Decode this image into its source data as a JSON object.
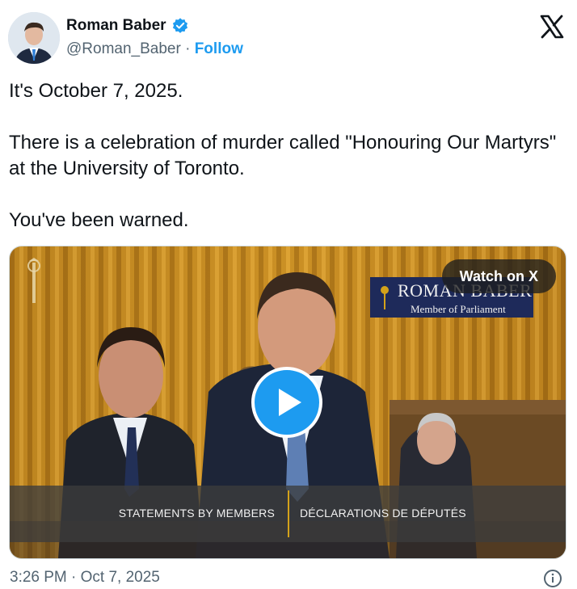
{
  "author": {
    "name": "Roman Baber",
    "handle": "@Roman_Baber",
    "separator": "·",
    "follow_label": "Follow",
    "verified_icon": "verified-badge-icon",
    "accent_color": "#1d9bf0"
  },
  "brand_icon": "x-logo-icon",
  "tweet": {
    "paragraphs": [
      "It's October 7, 2025.",
      "There is a celebration of murder called \"Honouring Our Martyrs\" at the University of Toronto.",
      "You've been warned."
    ]
  },
  "media": {
    "watch_label": "Watch on X",
    "play_icon": "play-icon",
    "nameplate_name": "ROMAN BABER",
    "nameplate_title": "Member of Parliament",
    "caption_en": "STATEMENTS BY MEMBERS",
    "caption_fr": "DÉCLARATIONS DE DÉPUTÉS"
  },
  "footer": {
    "timestamp": "3:26 PM · Oct 7, 2025",
    "info_icon": "info-icon"
  }
}
